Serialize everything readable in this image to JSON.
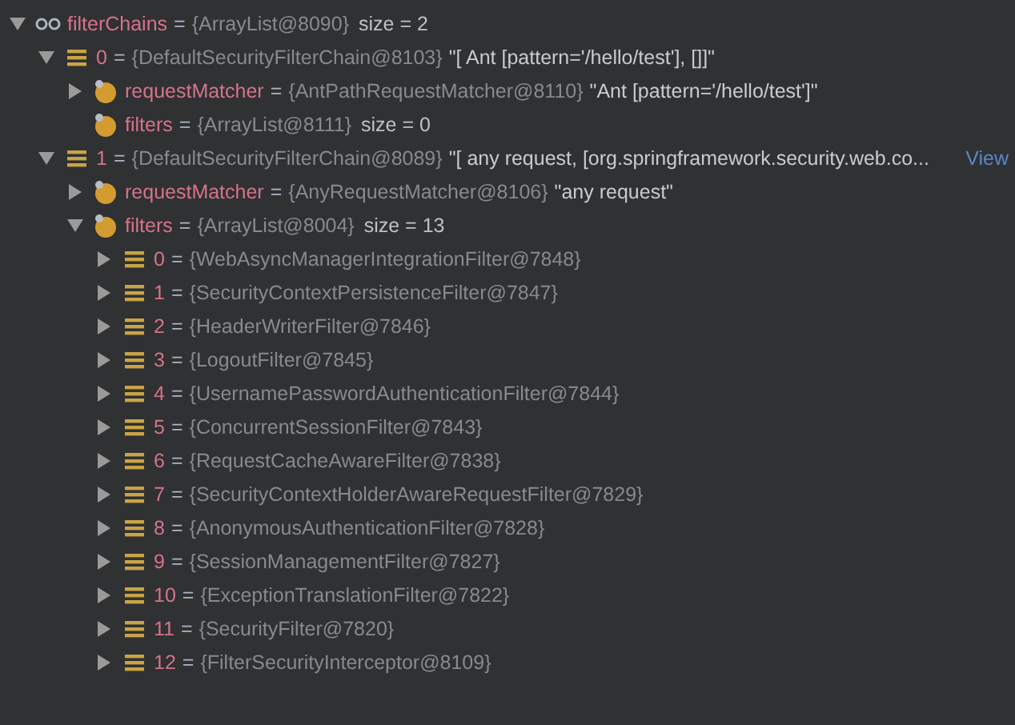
{
  "variables": [
    {
      "kind": "watch",
      "name": "filterChains",
      "sep": "=",
      "type": "{ArrayList@8090}",
      "size": "size = 2",
      "expanded": true,
      "children": [
        {
          "kind": "item",
          "name": "0",
          "sep": "=",
          "type": "{DefaultSecurityFilterChain@8103}",
          "value": "\"[ Ant [pattern='/hello/test'], []]\"",
          "expanded": true,
          "children": [
            {
              "kind": "field",
              "name": "requestMatcher",
              "sep": "=",
              "type": "{AntPathRequestMatcher@8110}",
              "value": "\"Ant [pattern='/hello/test']\"",
              "expanded": false
            },
            {
              "kind": "field",
              "name": "filters",
              "sep": "=",
              "type": "{ArrayList@8111}",
              "size": "size = 0"
            }
          ]
        },
        {
          "kind": "item",
          "name": "1",
          "sep": "=",
          "type": "{DefaultSecurityFilterChain@8089}",
          "value": "\"[ any request, [org.springframework.security.web.co...",
          "link": "View",
          "expanded": true,
          "children": [
            {
              "kind": "field",
              "name": "requestMatcher",
              "sep": "=",
              "type": "{AnyRequestMatcher@8106}",
              "value": "\"any request\"",
              "expanded": false
            },
            {
              "kind": "field",
              "name": "filters",
              "sep": "=",
              "type": "{ArrayList@8004}",
              "size": "size = 13",
              "expanded": true,
              "children": [
                {
                  "kind": "item",
                  "name": "0",
                  "sep": "=",
                  "type": "{WebAsyncManagerIntegrationFilter@7848}",
                  "expanded": false
                },
                {
                  "kind": "item",
                  "name": "1",
                  "sep": "=",
                  "type": "{SecurityContextPersistenceFilter@7847}",
                  "expanded": false
                },
                {
                  "kind": "item",
                  "name": "2",
                  "sep": "=",
                  "type": "{HeaderWriterFilter@7846}",
                  "expanded": false
                },
                {
                  "kind": "item",
                  "name": "3",
                  "sep": "=",
                  "type": "{LogoutFilter@7845}",
                  "expanded": false
                },
                {
                  "kind": "item",
                  "name": "4",
                  "sep": "=",
                  "type": "{UsernamePasswordAuthenticationFilter@7844}",
                  "expanded": false
                },
                {
                  "kind": "item",
                  "name": "5",
                  "sep": "=",
                  "type": "{ConcurrentSessionFilter@7843}",
                  "expanded": false
                },
                {
                  "kind": "item",
                  "name": "6",
                  "sep": "=",
                  "type": "{RequestCacheAwareFilter@7838}",
                  "expanded": false
                },
                {
                  "kind": "item",
                  "name": "7",
                  "sep": "=",
                  "type": "{SecurityContextHolderAwareRequestFilter@7829}",
                  "expanded": false
                },
                {
                  "kind": "item",
                  "name": "8",
                  "sep": "=",
                  "type": "{AnonymousAuthenticationFilter@7828}",
                  "expanded": false
                },
                {
                  "kind": "item",
                  "name": "9",
                  "sep": "=",
                  "type": "{SessionManagementFilter@7827}",
                  "expanded": false
                },
                {
                  "kind": "item",
                  "name": "10",
                  "sep": "=",
                  "type": "{ExceptionTranslationFilter@7822}",
                  "expanded": false
                },
                {
                  "kind": "item",
                  "name": "11",
                  "sep": "=",
                  "type": "{SecurityFilter@7820}",
                  "expanded": false
                },
                {
                  "kind": "item",
                  "name": "12",
                  "sep": "=",
                  "type": "{FilterSecurityInterceptor@8109}",
                  "expanded": false
                }
              ]
            }
          ]
        }
      ]
    }
  ]
}
